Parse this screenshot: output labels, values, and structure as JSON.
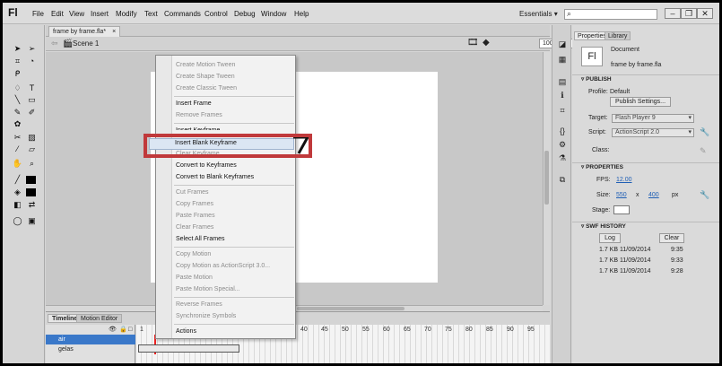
{
  "app": {
    "logo": "Fl",
    "menu": [
      "File",
      "Edit",
      "View",
      "Insert",
      "Modify",
      "Text",
      "Commands",
      "Control",
      "Debug",
      "Window",
      "Help"
    ],
    "workspace": "Essentials",
    "search_placeholder": ""
  },
  "document": {
    "tab_label": "frame by frame.fla*",
    "tab_close": "×",
    "scene": "Scene 1",
    "zoom": "100%"
  },
  "timeline": {
    "tabs": [
      "Timeline",
      "Motion Editor"
    ],
    "layers": [
      "air",
      "gelas"
    ],
    "frame_numbers": [
      "1",
      "40",
      "45",
      "50",
      "55",
      "60",
      "65",
      "70",
      "75",
      "80",
      "85",
      "90",
      "95"
    ]
  },
  "context_menu": {
    "items": [
      {
        "label": "Create Motion Tween",
        "enabled": false
      },
      {
        "label": "Create Shape Tween",
        "enabled": false
      },
      {
        "label": "Create Classic Tween",
        "enabled": false
      },
      {
        "label": "Insert Frame",
        "enabled": true
      },
      {
        "label": "Remove Frames",
        "enabled": false
      },
      {
        "label": "Insert Keyframe",
        "enabled": true
      },
      {
        "label": "Insert Blank Keyframe",
        "enabled": true
      },
      {
        "label": "Clear Keyframe",
        "enabled": false
      },
      {
        "label": "Convert to Keyframes",
        "enabled": true
      },
      {
        "label": "Convert to Blank Keyframes",
        "enabled": true
      },
      {
        "label": "Cut Frames",
        "enabled": false
      },
      {
        "label": "Copy Frames",
        "enabled": false
      },
      {
        "label": "Paste Frames",
        "enabled": false
      },
      {
        "label": "Clear Frames",
        "enabled": false
      },
      {
        "label": "Select All Frames",
        "enabled": true
      },
      {
        "label": "Copy Motion",
        "enabled": false
      },
      {
        "label": "Copy Motion as ActionScript 3.0...",
        "enabled": false
      },
      {
        "label": "Paste Motion",
        "enabled": false
      },
      {
        "label": "Paste Motion Special...",
        "enabled": false
      },
      {
        "label": "Reverse Frames",
        "enabled": false
      },
      {
        "label": "Synchronize Symbols",
        "enabled": false
      },
      {
        "label": "Actions",
        "enabled": true
      }
    ],
    "highlight_color": "#c0393b"
  },
  "properties": {
    "tabs": [
      "Properties",
      "Library"
    ],
    "doc_icon": "Fl",
    "doc_type": "Document",
    "doc_name": "frame by frame.fla",
    "publish_header": "PUBLISH",
    "profile_label": "Profile:",
    "profile_value": "Default",
    "publish_settings": "Publish Settings...",
    "target_label": "Target:",
    "target_value": "Flash Player 9",
    "script_label": "Script:",
    "script_value": "ActionScript 2.0",
    "class_label": "Class:",
    "properties_header": "PROPERTIES",
    "fps_label": "FPS:",
    "fps_value": "12.00",
    "size_label": "Size:",
    "width": "550",
    "x_sep": "x",
    "height": "400",
    "unit": "px",
    "stage_label": "Stage:",
    "swf_header": "SWF HISTORY",
    "log_button": "Log",
    "clear_button": "Clear",
    "history": [
      {
        "size": "1.7 KB",
        "date": "11/09/2014",
        "time": "9:35"
      },
      {
        "size": "1.7 KB",
        "date": "11/09/2014",
        "time": "9:33"
      },
      {
        "size": "1.7 KB",
        "date": "11/09/2014",
        "time": "9:28"
      }
    ]
  }
}
